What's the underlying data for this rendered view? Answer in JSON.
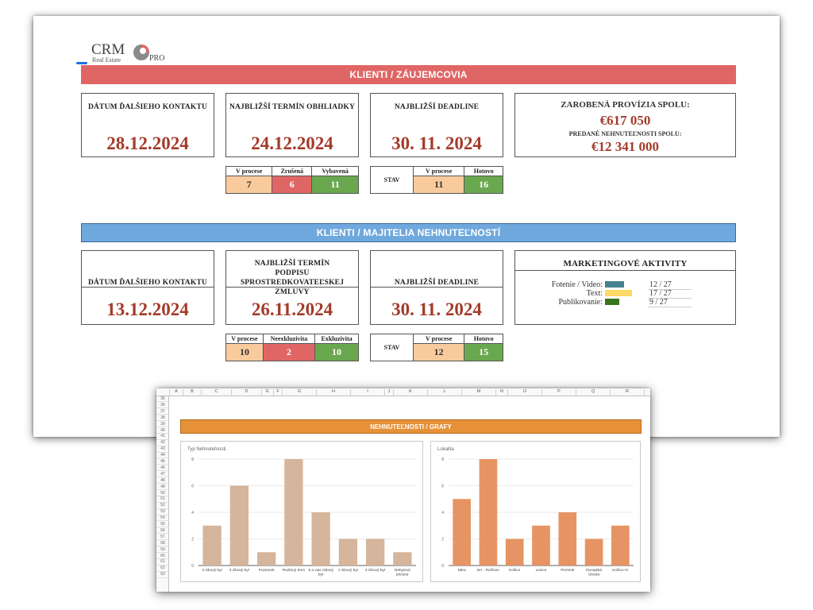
{
  "logo": {
    "main": "CRM",
    "sub": "Real Estate",
    "suffix": "PRO"
  },
  "section1": {
    "banner": "KLIENTI / ZÁUJEMCOVIA",
    "next_contact": {
      "label": "DÁTUM ĎALŠIEHO KONTAKTU",
      "date": "28.12.2024"
    },
    "next_viewing": {
      "label": "NAJBLIŽŠÍ TERMÍN OBHLIADKY",
      "date": "24.12.2024"
    },
    "next_deadline": {
      "label": "NAJBLIŽŠÍ DEADLINE",
      "date": "30. 11. 2024"
    },
    "commission": {
      "label": "ZAROBENÁ PROVÍZIA SPOLU:",
      "value": "€617 050",
      "sold_label": "PREDANÉ NEHNUTEĽNOSTI SPOLU:",
      "sold_value": "€12 341 000"
    },
    "viewing_status": {
      "headers": [
        "V procese",
        "Zrušená",
        "Vybavená"
      ],
      "values": [
        "7",
        "6",
        "11"
      ]
    },
    "deadline_status": {
      "row_label": "STAV",
      "headers": [
        "V procese",
        "Hotovo"
      ],
      "values": [
        "11",
        "16"
      ]
    }
  },
  "section2": {
    "banner": "KLIENTI / MAJITELIA NEHNUTEĽNOSTÍ",
    "next_contact": {
      "label": "DÁTUM ĎALŠIEHO KONTAKTU",
      "date": "13.12.2024"
    },
    "next_signing": {
      "label": "NAJBLIŽŠÍ TERMÍN PODPISU SPROSTREDKOVATEĽSKEJ ZMLUVY",
      "date": "26.11.2024"
    },
    "next_deadline": {
      "label": "NAJBLIŽŠÍ DEADLINE",
      "date": "30. 11. 2024"
    },
    "marketing": {
      "title": "MARKETINGOVÉ AKTIVITY",
      "rows": [
        {
          "label": "Fotenie / Video:",
          "count": "12 / 27",
          "progress": 0.44,
          "color": "#45818e"
        },
        {
          "label": "Text:",
          "count": "17 / 27",
          "progress": 0.63,
          "color": "#ffd966"
        },
        {
          "label": "Publikovanie:",
          "count": "9 / 27",
          "progress": 0.33,
          "color": "#38761d"
        }
      ]
    },
    "contract_status": {
      "headers": [
        "V procese",
        "Neexkluzivita",
        "Exkluzivita"
      ],
      "values": [
        "10",
        "2",
        "10"
      ]
    },
    "deadline_status": {
      "row_label": "STAV",
      "headers": [
        "V procese",
        "Hotovo"
      ],
      "values": [
        "12",
        "15"
      ]
    }
  },
  "spreadsheet": {
    "columns": [
      "A",
      "B",
      "C",
      "D",
      "E",
      "F",
      "G",
      "H",
      "I",
      "J",
      "K",
      "L",
      "M",
      "N",
      "O",
      "P",
      "Q",
      "R",
      "S"
    ],
    "rows": [
      "35",
      "36",
      "37",
      "38",
      "39",
      "40",
      "41",
      "42",
      "43",
      "44",
      "45",
      "46",
      "47",
      "48",
      "49",
      "50",
      "51",
      "52",
      "53",
      "54",
      "55",
      "56",
      "57",
      "58",
      "59",
      "60",
      "61",
      "62",
      "63"
    ],
    "banner": "NEHNUTEĽNOSTI / GRAFY"
  },
  "chart_data": [
    {
      "type": "bar",
      "title": "Typ Nehnuteľnosti",
      "categories": [
        "2 izbový byt",
        "3 izbový byt",
        "Pozemok",
        "Rodinný dom",
        "5 a viac izbový byt",
        "1 izbový byt",
        "4 izbový byt",
        "Nebytový priestor"
      ],
      "values": [
        3,
        6,
        1,
        8,
        4,
        2,
        2,
        1
      ],
      "yticks": [
        "0",
        "2",
        "4",
        "6",
        "8"
      ],
      "ylim": [
        0,
        8
      ],
      "color": "#d5b59c",
      "grid": true
    },
    {
      "type": "bar",
      "title": "Lokalita",
      "categories": [
        "Nitra",
        "BA - Ružinov",
        "Košice",
        "Levice",
        "Pezinok",
        "Dunajská Streda",
        "Košice IV"
      ],
      "values": [
        5,
        8,
        2,
        3,
        4,
        2,
        3
      ],
      "yticks": [
        "0",
        "2",
        "4",
        "6",
        "8"
      ],
      "ylim": [
        0,
        8
      ],
      "color": "#e69463",
      "grid": true
    }
  ]
}
